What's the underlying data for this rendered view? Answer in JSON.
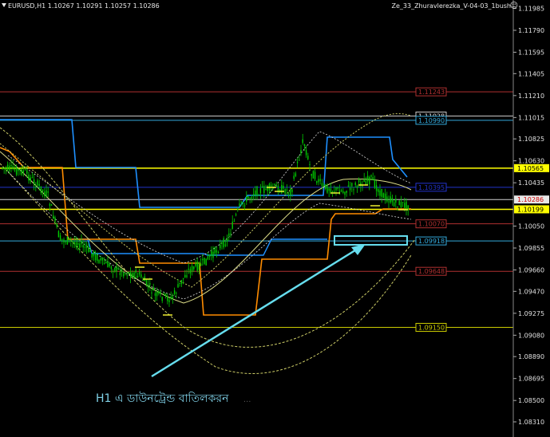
{
  "header": {
    "symbol_info": "EURUSD,H1  1.10267 1.10291 1.10257 1.10286",
    "indicator_name": "Ze_33_Zhuravlerezka_V-04-03_1bush",
    "smiley": "☺"
  },
  "caption": {
    "text": "H1 এ ডাউনট্রেন্ড বাতিলকরন",
    "dots": "..."
  },
  "price_scale": [
    {
      "label": "1.11985",
      "value": 1.11985
    },
    {
      "label": "1.11790",
      "value": 1.1179
    },
    {
      "label": "1.11595",
      "value": 1.11595
    },
    {
      "label": "1.11405",
      "value": 1.11405
    },
    {
      "label": "1.11210",
      "value": 1.1121
    },
    {
      "label": "1.11015",
      "value": 1.11015
    },
    {
      "label": "1.10825",
      "value": 1.10825
    },
    {
      "label": "1.10630",
      "value": 1.1063
    },
    {
      "label": "1.10435",
      "value": 1.10435
    },
    {
      "label": "1.10050",
      "value": 1.1005
    },
    {
      "label": "1.09855",
      "value": 1.09855
    },
    {
      "label": "1.09660",
      "value": 1.0966
    },
    {
      "label": "1.09470",
      "value": 1.0947
    },
    {
      "label": "1.09275",
      "value": 1.09275
    },
    {
      "label": "1.09080",
      "value": 1.0908
    },
    {
      "label": "1.08890",
      "value": 1.0889
    },
    {
      "label": "1.08695",
      "value": 1.08695
    },
    {
      "label": "1.08500",
      "value": 1.085
    },
    {
      "label": "1.08310",
      "value": 1.0831
    }
  ],
  "level_lines": [
    {
      "label": "1.11243",
      "value": 1.11243,
      "color": "#b03030",
      "boxed": true
    },
    {
      "label": "1.11028",
      "value": 1.11028,
      "color": "#c8c8c8",
      "boxed": true
    },
    {
      "label": "1.10990",
      "value": 1.1099,
      "color": "#33aadd",
      "boxed": true
    },
    {
      "label": "1.10565",
      "value": 1.10565,
      "color": "#ffff00",
      "boxed": true,
      "tag": true
    },
    {
      "label": "1.10395",
      "value": 1.10395,
      "color": "#2233cc",
      "boxed": true
    },
    {
      "label": "1.10286",
      "value": 1.10286,
      "color": "#d0d0d0",
      "boxed": false,
      "tag": true,
      "red": true
    },
    {
      "label": "1.10199",
      "value": 1.10199,
      "color": "#ffff00",
      "boxed": true,
      "tag": true
    },
    {
      "label": "1.10070",
      "value": 1.1007,
      "color": "#b03030",
      "boxed": true
    },
    {
      "label": "1.09918",
      "value": 1.09918,
      "color": "#33aadd",
      "boxed": true
    },
    {
      "label": "1.09648",
      "value": 1.09648,
      "color": "#b03030",
      "boxed": true
    },
    {
      "label": "1.09150",
      "value": 1.0915,
      "color": "#cccc00",
      "boxed": true
    }
  ],
  "colors": {
    "background": "#000000",
    "candles": "#00cc00",
    "blue_channel": "#1e90ff",
    "orange_channel": "#ff8c00",
    "envelope": "#cccc66",
    "arrow": "#66ddee",
    "highlight_box": "#66ddee"
  },
  "icons": [
    "chevron-down-icon",
    "smiley-icon"
  ]
}
